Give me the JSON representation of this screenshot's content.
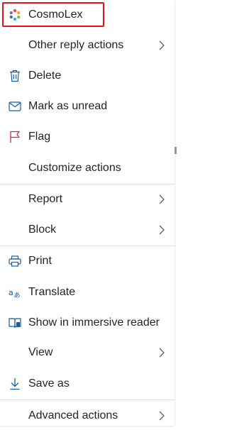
{
  "menu": {
    "items": [
      {
        "label": "CosmoLex",
        "icon": "cosmolex-logo-icon"
      },
      {
        "label": "Other reply actions",
        "icon": ""
      },
      {
        "label": "Delete",
        "icon": "trash-icon"
      },
      {
        "label": "Mark as unread",
        "icon": "envelope-icon"
      },
      {
        "label": "Flag",
        "icon": "flag-icon"
      },
      {
        "label": "Customize actions",
        "icon": ""
      },
      {
        "label": "Report",
        "icon": ""
      },
      {
        "label": "Block",
        "icon": ""
      },
      {
        "label": "Print",
        "icon": "printer-icon"
      },
      {
        "label": "Translate",
        "icon": "translate-icon"
      },
      {
        "label": "Show in immersive reader",
        "icon": "immersive-reader-icon"
      },
      {
        "label": "View",
        "icon": ""
      },
      {
        "label": "Save as",
        "icon": "download-icon"
      },
      {
        "label": "Advanced actions",
        "icon": ""
      }
    ]
  },
  "colors": {
    "icon_blue": "#115ea3",
    "flag_red": "#c4314b",
    "highlight_red": "#e3131a",
    "text": "#242424"
  }
}
